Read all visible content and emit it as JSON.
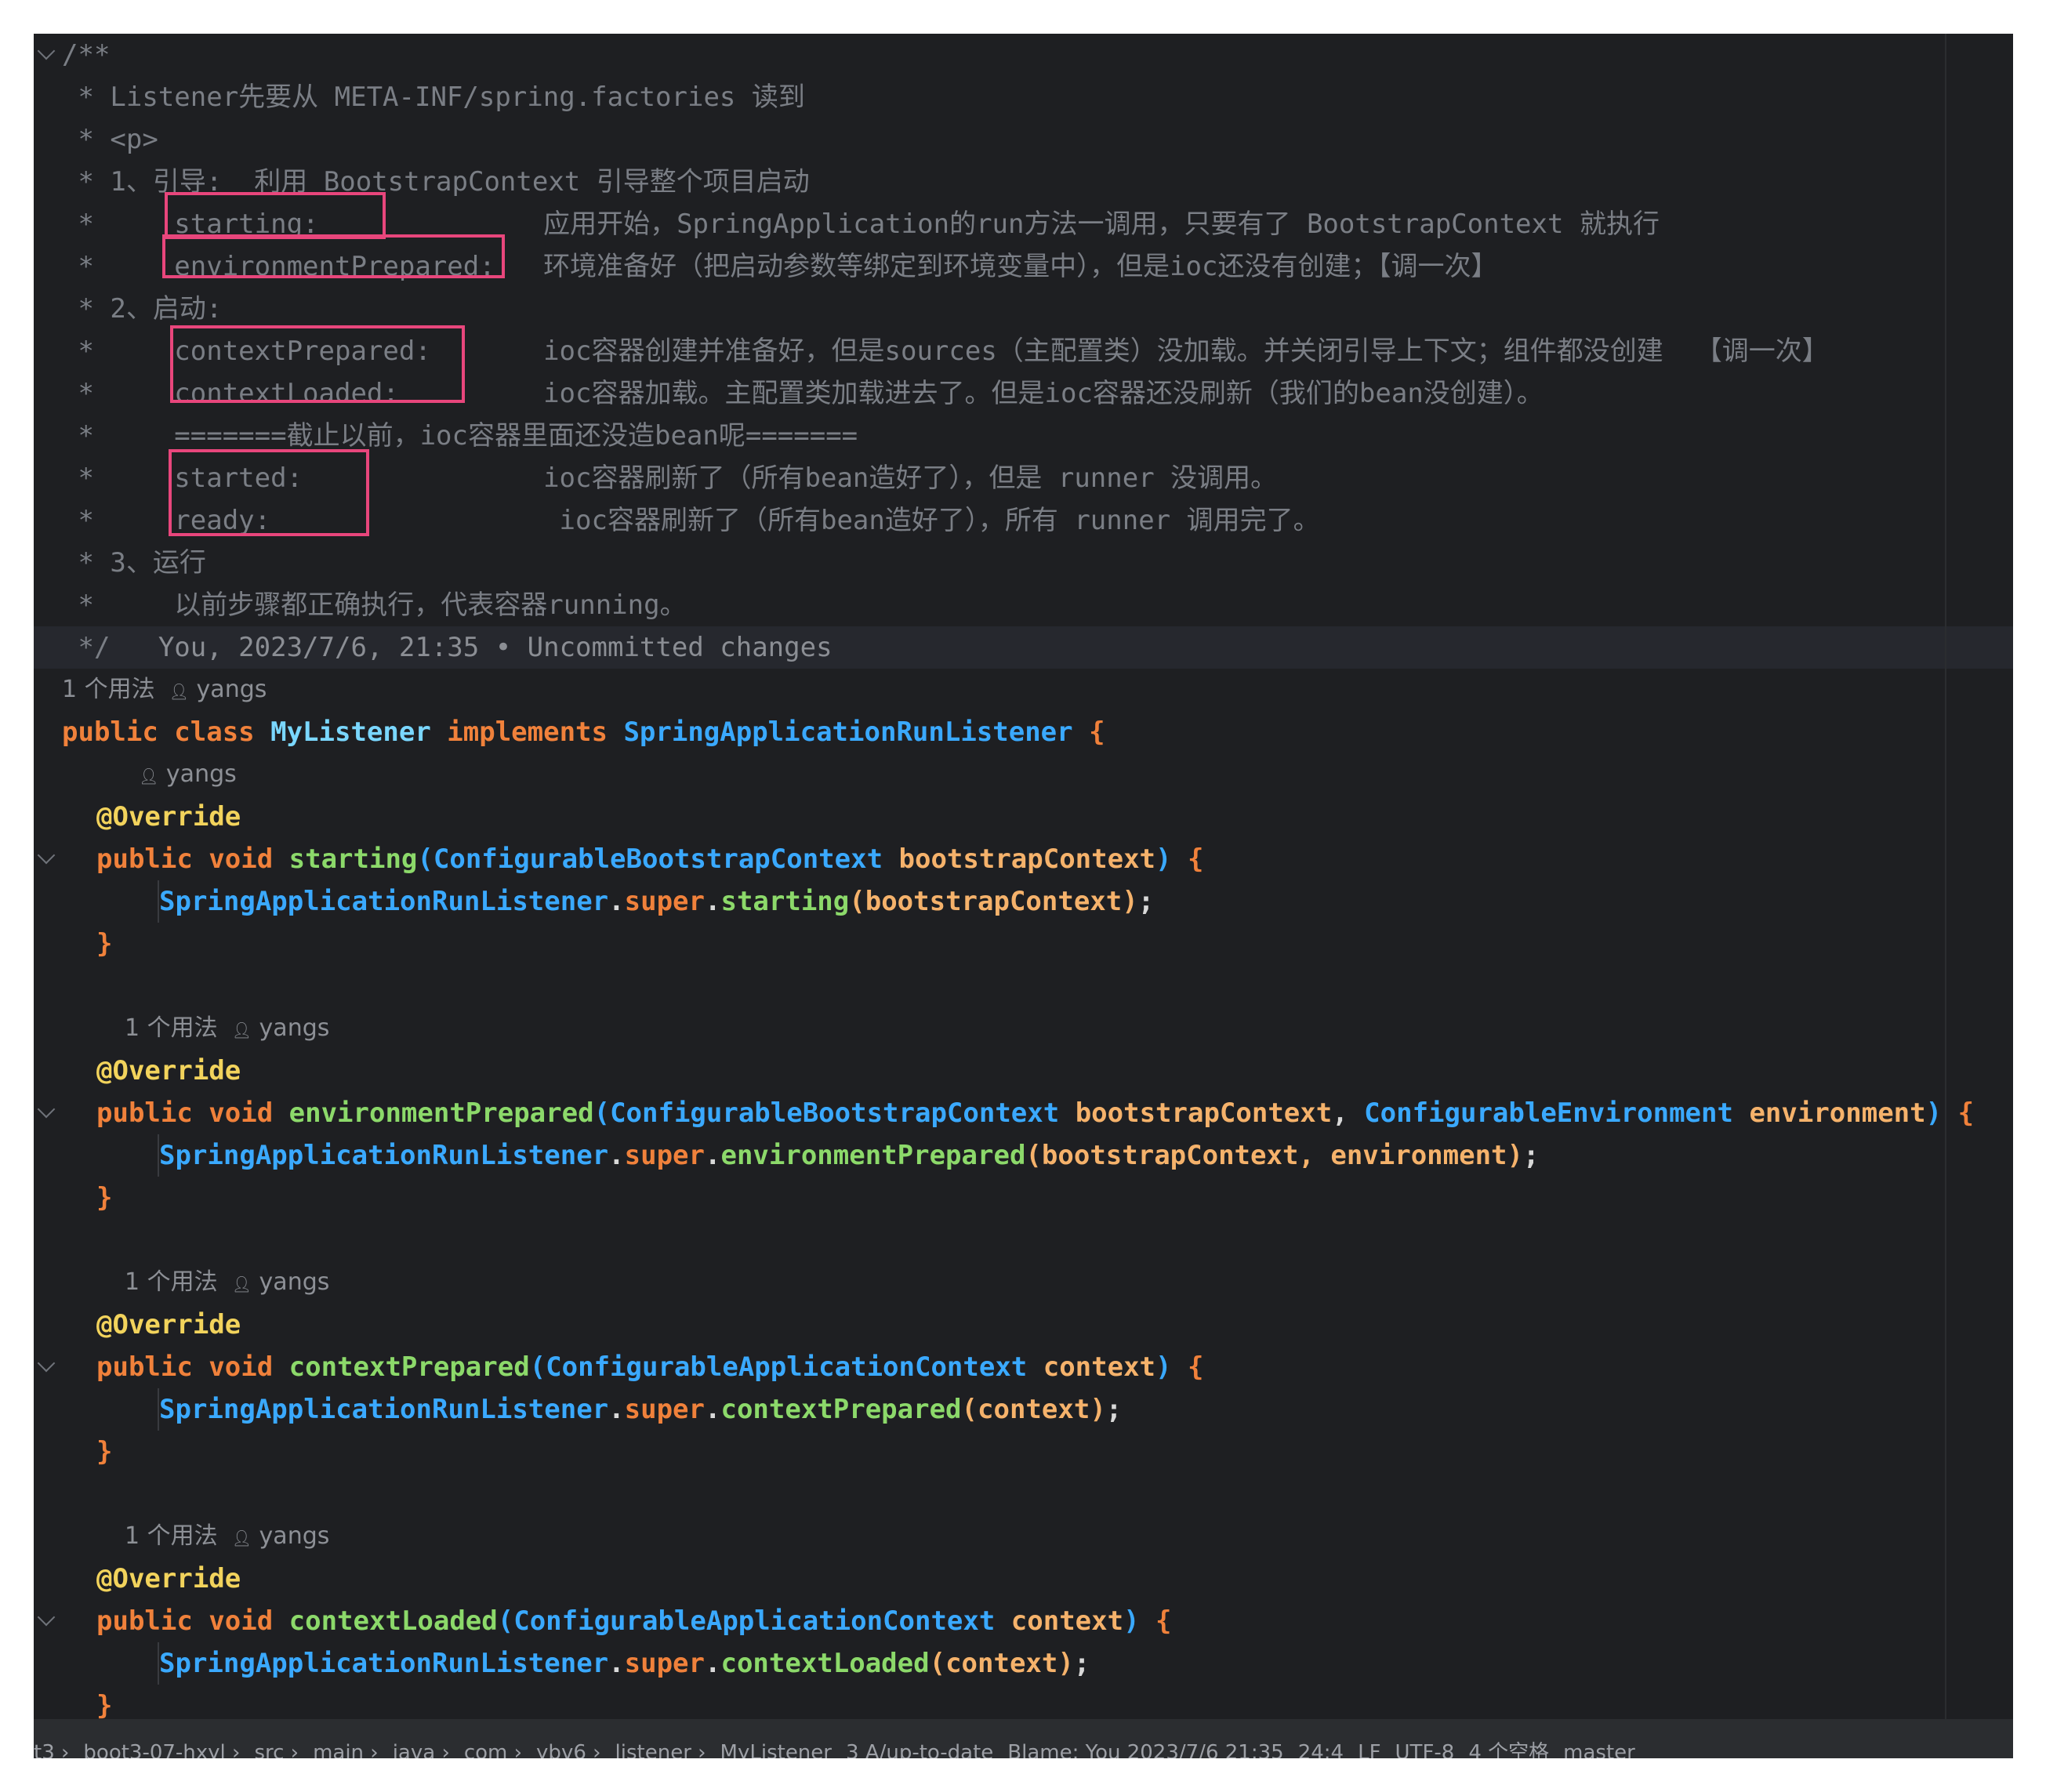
{
  "editor": {
    "comment_lines": [
      "/**",
      " * Listener先要从 META-INF/spring.factories 读到",
      " * <p>",
      " * 1、引导:  利用 BootstrapContext 引导整个项目启动",
      " *     starting:              应用开始，SpringApplication的run方法一调用，只要有了 BootstrapContext 就执行",
      " *     environmentPrepared:   环境准备好（把启动参数等绑定到环境变量中），但是ioc还没有创建；【调一次】",
      " * 2、启动:",
      " *     contextPrepared:       ioc容器创建并准备好，但是sources（主配置类）没加载。并关闭引导上下文；组件都没创建  【调一次】",
      " *     contextLoaded:         ioc容器加载。主配置类加载进去了。但是ioc容器还没刷新（我们的bean没创建）。",
      " *     =======截止以前，ioc容器里面还没造bean呢=======",
      " *     started:               ioc容器刷新了（所有bean造好了），但是 runner 没调用。",
      " *     ready:                  ioc容器刷新了（所有bean造好了），所有 runner 调用完了。",
      " * 3、运行",
      " *     以前步骤都正确执行，代表容器running。"
    ],
    "comment_end": " */",
    "blame_inline": "You, 2023/7/6, 21:35 • Uncommitted changes",
    "usage_hint": "1 个用法",
    "author": "yangs",
    "class_decl": {
      "kw1": "public",
      "kw2": "class",
      "name": "MyListener",
      "kw3": "implements",
      "iface": "SpringApplicationRunListener",
      "brace": "{"
    },
    "annotation": "@Override",
    "methods": [
      {
        "name": "starting",
        "params": [
          {
            "type": "ConfigurableBootstrapContext",
            "name": "bootstrapContext"
          }
        ],
        "call_args": "bootstrapContext",
        "show_usage": false
      },
      {
        "name": "environmentPrepared",
        "params": [
          {
            "type": "ConfigurableBootstrapContext",
            "name": "bootstrapContext"
          },
          {
            "type": "ConfigurableEnvironment",
            "name": "environment"
          }
        ],
        "call_args": "bootstrapContext, environment",
        "show_usage": true
      },
      {
        "name": "contextPrepared",
        "params": [
          {
            "type": "ConfigurableApplicationContext",
            "name": "context"
          }
        ],
        "call_args": "context",
        "show_usage": true
      },
      {
        "name": "contextLoaded",
        "params": [
          {
            "type": "ConfigurableApplicationContext",
            "name": "context"
          }
        ],
        "call_args": "context",
        "show_usage": true
      }
    ],
    "super_ref": "SpringApplicationRunListener",
    "super_kw": "super",
    "modifiers": "public void"
  },
  "status_bar": {
    "breadcrumbs": [
      "t3",
      "boot3-07-hxyl",
      "src",
      "main",
      "java",
      "com",
      "ybv6",
      "listener",
      "MyListener"
    ],
    "vcs": "3 A/up-to-date",
    "blame": "Blame: You 2023/7/6 21:35",
    "position": "24:4",
    "line_ending": "LF",
    "encoding": "UTF-8",
    "indent": "4 个空格",
    "branch": "master"
  },
  "colors": {
    "background": "#1e1f22",
    "keyword": "#f0813b",
    "type": "#3aa9ff",
    "method": "#8cd96a",
    "parameter": "#f5b26b",
    "annotation": "#f2d35c",
    "highlight_box": "#e8467c"
  }
}
